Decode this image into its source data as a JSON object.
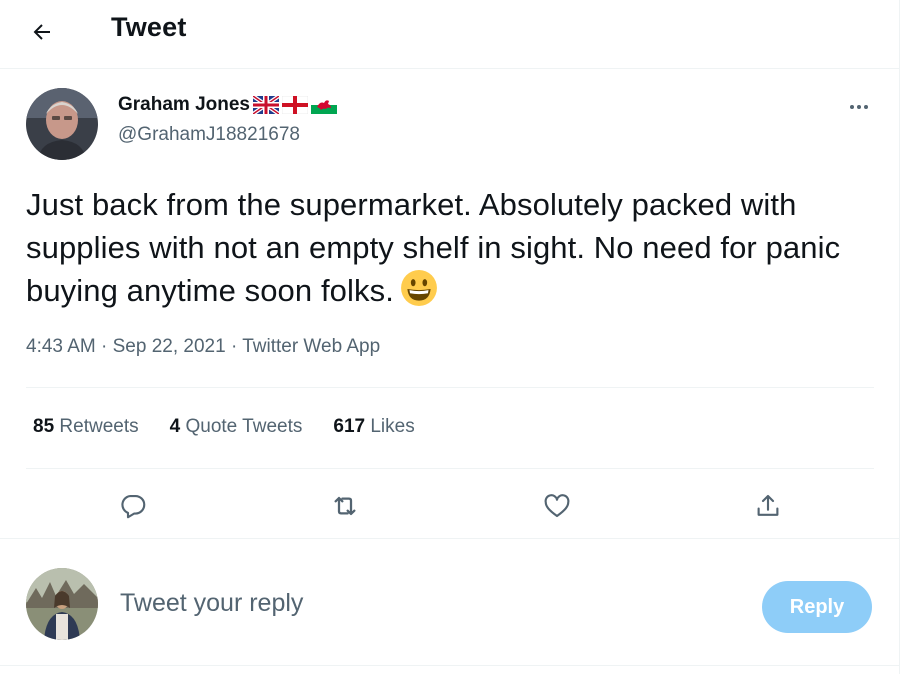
{
  "header": {
    "title": "Tweet"
  },
  "author": {
    "name": "Graham Jones",
    "handle": "@GrahamJ18821678"
  },
  "tweet": {
    "text": "Just back from the supermarket. Absolutely packed with supplies with not an empty shelf in sight. No need for panic buying anytime soon folks.",
    "time": "4:43 AM",
    "date": "Sep 22, 2021",
    "source": "Twitter Web App",
    "separator": "·"
  },
  "stats": {
    "retweets_count": "85",
    "retweets_label": "Retweets",
    "quotes_count": "4",
    "quotes_label": "Quote Tweets",
    "likes_count": "617",
    "likes_label": "Likes"
  },
  "reply": {
    "placeholder": "Tweet your reply",
    "button_label": "Reply"
  },
  "icons": {
    "back": "arrow-left-icon",
    "more": "more-dots-icon",
    "reply": "comment-bubble-icon",
    "retweet": "retweet-icon",
    "like": "heart-icon",
    "share": "share-icon",
    "flags": [
      "union-jack-flag",
      "england-flag",
      "wales-flag"
    ],
    "emoji": "smiling-face-emoji"
  },
  "colors": {
    "text": "#0f1419",
    "secondary": "#536471",
    "reply_button": "#8ecdf8",
    "divider": "#eff3f4"
  }
}
